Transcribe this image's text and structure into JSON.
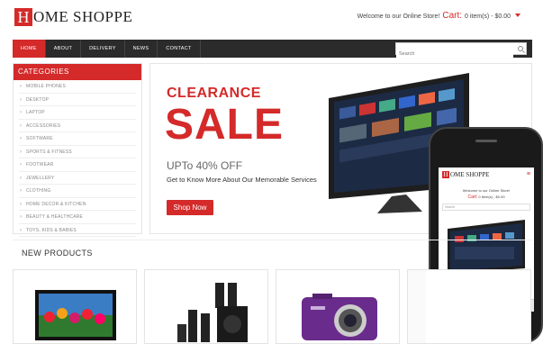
{
  "header": {
    "logo_initial": "H",
    "logo_rest": "OME SHOPPE",
    "welcome_text": "Welcome to our Online Store!",
    "cart_label": "Cart:",
    "cart_summary": "0 item(s) - $0.00"
  },
  "nav": {
    "items": [
      "HOME",
      "ABOUT",
      "DELIVERY",
      "NEWS",
      "CONTACT"
    ],
    "active_index": 0,
    "search_placeholder": "Search"
  },
  "sidebar": {
    "title": "CATEGORIES",
    "items": [
      "MOBILE PHONES",
      "DESKTOP",
      "LAPTOP",
      "ACCESSORIES",
      "SOFTWARE",
      "SPORTS & FITNESS",
      "FOOTWEAR",
      "JEWELLERY",
      "CLOTHING",
      "HOME DECOR & KITCHEN",
      "BEAUTY & HEALTHCARE",
      "TOYS, KIDS & BABIES"
    ]
  },
  "banner": {
    "line1": "CLEARANCE",
    "line2": "SALE",
    "offer": "UPTo 40% OFF",
    "description": "Get to Know More About Our Memorable Services",
    "button": "Shop Now"
  },
  "phone": {
    "logo_initial": "H",
    "logo_rest": "OME SHOPPE",
    "welcome_text": "Welcome to our Online Store!",
    "cart_label": "Cart:",
    "cart_summary": "0 item(s) - $0.00",
    "search_placeholder": "Search"
  },
  "new_products": {
    "title": "NEW PRODUCTS",
    "items": [
      "monitor-image",
      "speakers-image",
      "camera-image",
      "product-image"
    ]
  },
  "colors": {
    "accent": "#d42a2a",
    "nav_bg": "#2b2b2b"
  }
}
